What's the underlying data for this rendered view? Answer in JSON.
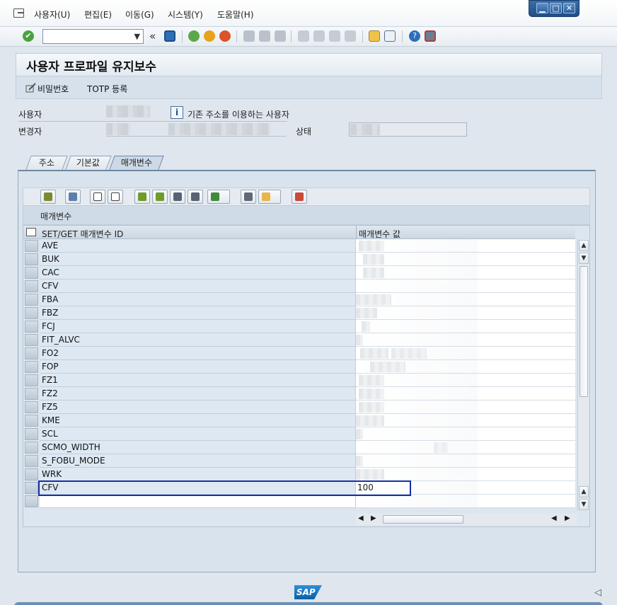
{
  "menu": {
    "items": [
      "사용자(U)",
      "편집(E)",
      "이동(G)",
      "시스템(Y)",
      "도움말(H)"
    ]
  },
  "toolbar": {
    "command_field": "",
    "back_arrows": "«"
  },
  "title": "사용자 프로파일 유지보수",
  "app_toolbar": {
    "password": "비밀번호",
    "totp": "TOTP 등록"
  },
  "header": {
    "user_label": "사용자",
    "address_text": "기존 주소를 이용하는 사용자",
    "changed_by_label": "변경자",
    "status_label": "상태"
  },
  "tabs": [
    "주소",
    "기본값",
    "매개변수"
  ],
  "grid": {
    "title": "매개변수",
    "col1_header": "SET/GET 매개변수 ID",
    "col2_header": "매개변수 값",
    "rows": [
      {
        "id": "AVE",
        "value": ""
      },
      {
        "id": "BUK",
        "value": ""
      },
      {
        "id": "CAC",
        "value": ""
      },
      {
        "id": "CFV",
        "value": ""
      },
      {
        "id": "FBA",
        "value": ""
      },
      {
        "id": "FBZ",
        "value": ""
      },
      {
        "id": "FCJ",
        "value": ""
      },
      {
        "id": "FIT_ALVC",
        "value": ""
      },
      {
        "id": "FO2",
        "value": ""
      },
      {
        "id": "FOP",
        "value": ""
      },
      {
        "id": "FZ1",
        "value": ""
      },
      {
        "id": "FZ2",
        "value": ""
      },
      {
        "id": "FZ5",
        "value": ""
      },
      {
        "id": "KME",
        "value": ""
      },
      {
        "id": "SCL",
        "value": ""
      },
      {
        "id": "SCMO_WIDTH",
        "value": ""
      },
      {
        "id": "S_FOBU_MODE",
        "value": ""
      },
      {
        "id": "WRK",
        "value": ""
      },
      {
        "id": "CFV",
        "value": "100"
      },
      {
        "id": "",
        "value": ""
      }
    ]
  },
  "footer": {
    "logo": "SAP"
  }
}
